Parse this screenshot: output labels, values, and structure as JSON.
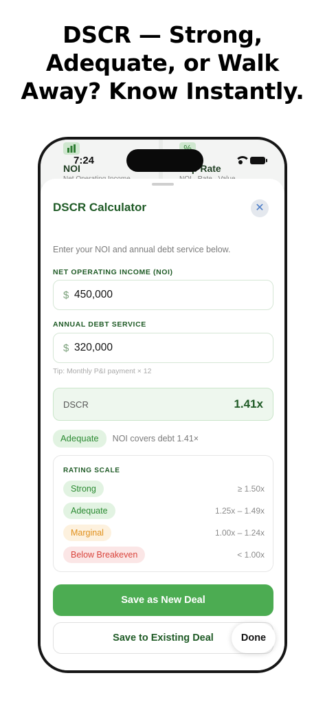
{
  "headline": {
    "line1": "DSCR — Strong,",
    "line2": "Adequate, or Walk",
    "line3": "Away? Know Instantly."
  },
  "status_bar": {
    "time": "7:24"
  },
  "background": {
    "left_card": {
      "icon": "bar-chart-icon",
      "title": "NOI",
      "subtitle": "Net Operating Income"
    },
    "right_card": {
      "icon": "percent-icon",
      "icon_glyph": "%",
      "title": "Cap Rate",
      "subtitle": "NOI · Rate · Value"
    }
  },
  "sheet": {
    "title": "DSCR Calculator",
    "close_glyph": "✕",
    "intro": "Enter your NOI and annual debt service below.",
    "noi": {
      "label": "NET OPERATING INCOME (NOI)",
      "currency": "$",
      "value": "450,000"
    },
    "debt": {
      "label": "ANNUAL DEBT SERVICE",
      "currency": "$",
      "value": "320,000"
    },
    "tip": "Tip: Monthly P&I payment × 12",
    "result": {
      "label": "DSCR",
      "value": "1.41x"
    },
    "status": {
      "badge": "Adequate",
      "text": "NOI covers debt 1.41×"
    },
    "scale": {
      "title": "RATING SCALE",
      "rows": [
        {
          "label": "Strong",
          "range": "≥ 1.50x",
          "color": "#2b8a32"
        },
        {
          "label": "Adequate",
          "range": "1.25x – 1.49x",
          "color": "#2b8a32"
        },
        {
          "label": "Marginal",
          "range": "1.00x – 1.24x",
          "color": "#e0901c"
        },
        {
          "label": "Below Breakeven",
          "range": "< 1.00x",
          "color": "#d9443c"
        }
      ]
    },
    "primary_button": "Save as New Deal",
    "secondary_button": "Save to Existing Deal",
    "done_button": "Done"
  },
  "colors": {
    "accent_green": "#4cac52",
    "title_green": "#1e5a25"
  }
}
